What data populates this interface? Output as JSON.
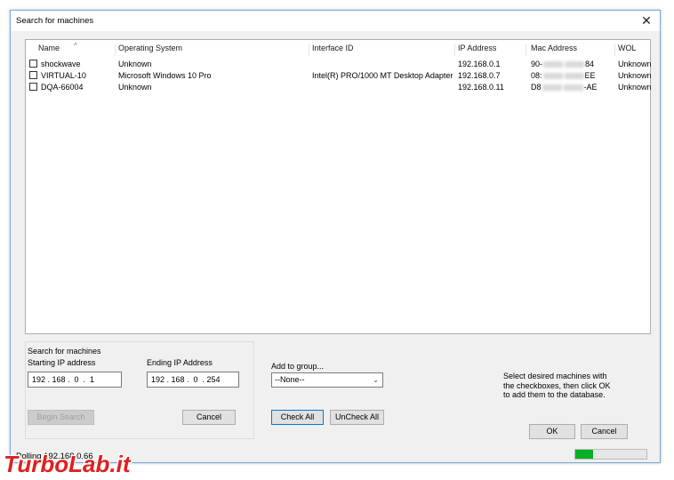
{
  "window": {
    "title": "Search for machines",
    "close_glyph": "✕"
  },
  "list": {
    "columns": [
      "Name",
      "Operating System",
      "Interface ID",
      "IP Address",
      "Mac Address",
      "WOL"
    ],
    "sort_glyph": "^",
    "rows": [
      {
        "name": "shockwave",
        "os": "Unknown",
        "iface": "",
        "ip": "192.168.0.1",
        "mac_start": "90-",
        "mac_end": "84",
        "wol": "Unknown"
      },
      {
        "name": "VIRTUAL-10",
        "os": "Microsoft Windows 10 Pro",
        "iface": "Intel(R) PRO/1000 MT Desktop Adapter",
        "ip": "192.168.0.7",
        "mac_start": "08:",
        "mac_end": "EE",
        "wol": "Unknown"
      },
      {
        "name": "DQA-66004",
        "os": "Unknown",
        "iface": "",
        "ip": "192.168.0.11",
        "mac_start": "D8",
        "mac_end": "-AE",
        "wol": "Unknown"
      }
    ]
  },
  "search": {
    "group_title": "Search for machines",
    "start_label": "Starting IP address",
    "end_label": "Ending IP Address",
    "start_ip": "192 . 168 .  0  .  1",
    "end_ip": "192 . 168 .  0  . 254",
    "begin_label": "Begin Search",
    "cancel_label": "Cancel"
  },
  "group": {
    "label": "Add to group...",
    "selected": "--None--",
    "check_all": "Check All",
    "uncheck_all": "UnCheck All"
  },
  "help_text": "Select desired machines with the checkboxes, then click OK to add them to the database.",
  "footer": {
    "ok_label": "OK",
    "cancel_label": "Cancel",
    "status": "Polling 192.168.0.66",
    "progress": 0.25,
    "progress_color": "#06b025"
  },
  "watermark": {
    "text": "TurboLab.it",
    "color": "#e02020"
  }
}
